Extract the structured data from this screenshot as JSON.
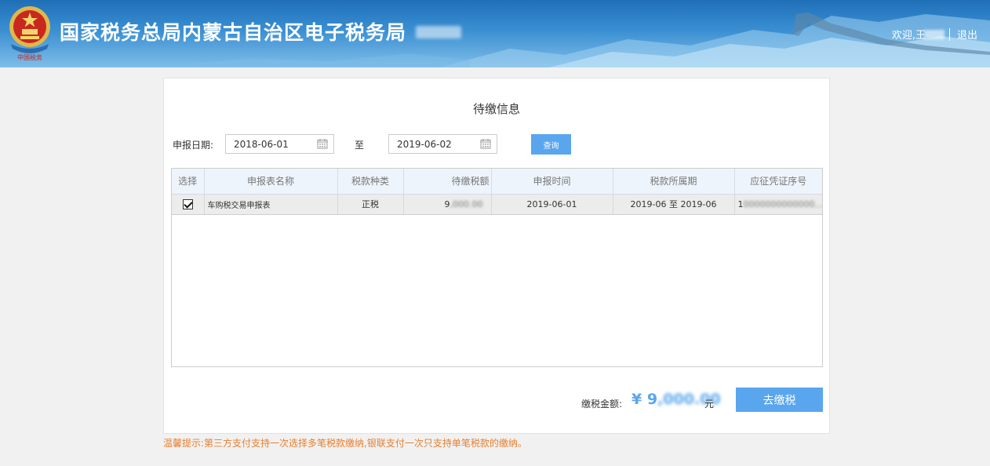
{
  "header": {
    "title": "国家税务总局内蒙古自治区电子税务局",
    "welcome": "欢迎,王",
    "logout": "退出"
  },
  "panel": {
    "title": "待缴信息",
    "date_label": "申报日期:",
    "date_start": "2018-06-01",
    "date_to": "至",
    "date_end": "2019-06-02",
    "query_button": "查询"
  },
  "table": {
    "headers": [
      "选择",
      "申报表名称",
      "税款种类",
      "待缴税额",
      "申报时间",
      "税款所属期",
      "应征凭证序号"
    ],
    "rows": [
      {
        "selected": true,
        "name": "车购税交易申报表",
        "tax_type": "正税",
        "amount": "9",
        "declare_date": "2019-06-01",
        "period": "2019-06 至 2019-06",
        "voucher": "1"
      }
    ]
  },
  "footer": {
    "total_label": "缴税金额:",
    "currency": "¥",
    "total_amount": "9",
    "unit": "元",
    "pay_button": "去缴税"
  },
  "tip": "温馨提示:第三方支付支持一次选择多笔税款缴纳,银联支付一次只支持单笔税款的缴纳。",
  "colors": {
    "accent": "#5aa6ee",
    "tip": "#e87f2f",
    "header_top": "#1f6fb8"
  },
  "icons": [
    "national-emblem-icon",
    "calendar-icon",
    "checkbox-checked-icon"
  ]
}
